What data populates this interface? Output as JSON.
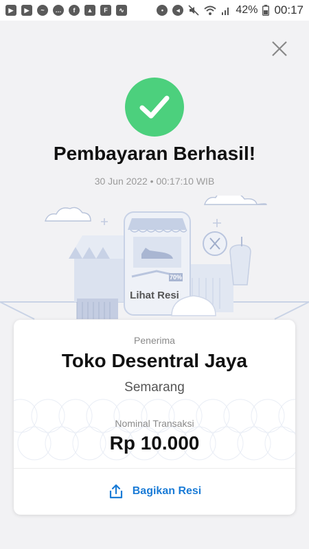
{
  "status_bar": {
    "notif_icons": [
      "youtube-icon",
      "youtube-icon",
      "messenger-icon",
      "chat-icon",
      "flip-icon",
      "gallery-icon",
      "flipboard-icon",
      "activity-icon"
    ],
    "battery": "42%",
    "time": "00:17"
  },
  "header": {
    "title": "Pembayaran Berhasil!",
    "datetime": "30 Jun 2022 • 00:17:10 WIB"
  },
  "illustration": {
    "link_label": "Lihat Resi",
    "badge": "70%"
  },
  "receipt": {
    "recipient_label": "Penerima",
    "merchant_name": "Toko Desentral Jaya",
    "city": "Semarang",
    "amount_label": "Nominal Transaksi",
    "amount": "Rp 10.000",
    "share_label": "Bagikan Resi"
  },
  "colors": {
    "success": "#4cd07d",
    "link": "#1a7bd6",
    "background": "#f2f2f4"
  }
}
